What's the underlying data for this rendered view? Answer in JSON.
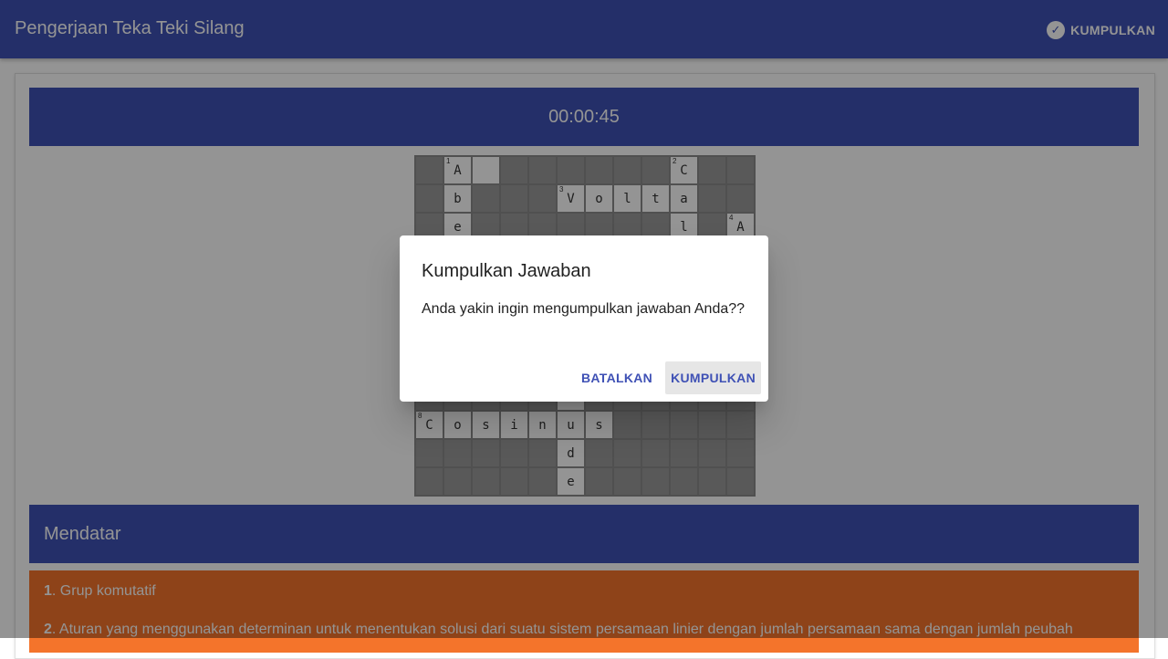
{
  "appbar": {
    "title": "Pengerjaan Teka Teki Silang",
    "submit_label": "KUMPULKAN",
    "submit_icon": "check-circle-icon"
  },
  "timer": {
    "value": "00:00:45"
  },
  "crossword": {
    "columns": 12,
    "rows": [
      [
        {
          "t": "b"
        },
        {
          "t": "w",
          "c": "A",
          "n": "1"
        },
        {
          "t": "w",
          "c": ""
        },
        {
          "t": "b"
        },
        {
          "t": "b"
        },
        {
          "t": "b"
        },
        {
          "t": "b"
        },
        {
          "t": "b"
        },
        {
          "t": "b"
        },
        {
          "t": "w",
          "c": "C",
          "n": "2"
        },
        {
          "t": "b"
        },
        {
          "t": "b"
        }
      ],
      [
        {
          "t": "b"
        },
        {
          "t": "w",
          "c": "b"
        },
        {
          "t": "b"
        },
        {
          "t": "b"
        },
        {
          "t": "b"
        },
        {
          "t": "w",
          "c": "V",
          "n": "3"
        },
        {
          "t": "w",
          "c": "o"
        },
        {
          "t": "w",
          "c": "l"
        },
        {
          "t": "w",
          "c": "t"
        },
        {
          "t": "w",
          "c": "a"
        },
        {
          "t": "b"
        },
        {
          "t": "b"
        }
      ],
      [
        {
          "t": "b"
        },
        {
          "t": "w",
          "c": "e"
        },
        {
          "t": "b"
        },
        {
          "t": "b"
        },
        {
          "t": "b"
        },
        {
          "t": "b"
        },
        {
          "t": "b"
        },
        {
          "t": "b"
        },
        {
          "t": "b"
        },
        {
          "t": "w",
          "c": "l"
        },
        {
          "t": "b"
        },
        {
          "t": "w",
          "c": "A",
          "n": "4"
        }
      ],
      [
        {
          "t": "b"
        },
        {
          "t": "w",
          "c": ""
        },
        {
          "t": "b"
        },
        {
          "t": "b"
        },
        {
          "t": "b"
        },
        {
          "t": "b"
        },
        {
          "t": "b"
        },
        {
          "t": "b"
        },
        {
          "t": "b"
        },
        {
          "t": "w",
          "c": ""
        },
        {
          "t": "b"
        },
        {
          "t": "w",
          "c": ""
        }
      ],
      [
        {
          "t": "b"
        },
        {
          "t": "w",
          "c": ""
        },
        {
          "t": "b"
        },
        {
          "t": "b"
        },
        {
          "t": "b"
        },
        {
          "t": "b"
        },
        {
          "t": "b"
        },
        {
          "t": "b"
        },
        {
          "t": "b"
        },
        {
          "t": "w",
          "c": ""
        },
        {
          "t": "b"
        },
        {
          "t": "w",
          "c": ""
        }
      ],
      [
        {
          "t": "b"
        },
        {
          "t": "w",
          "c": ""
        },
        {
          "t": "b"
        },
        {
          "t": "b"
        },
        {
          "t": "b"
        },
        {
          "t": "b"
        },
        {
          "t": "b"
        },
        {
          "t": "b"
        },
        {
          "t": "b"
        },
        {
          "t": "w",
          "c": ""
        },
        {
          "t": "b"
        },
        {
          "t": "w",
          "c": ""
        }
      ],
      [
        {
          "t": "b"
        },
        {
          "t": "w",
          "c": ""
        },
        {
          "t": "b"
        },
        {
          "t": "b"
        },
        {
          "t": "b"
        },
        {
          "t": "b"
        },
        {
          "t": "b"
        },
        {
          "t": "b"
        },
        {
          "t": "b"
        },
        {
          "t": "w",
          "c": ""
        },
        {
          "t": "b"
        },
        {
          "t": "w",
          "c": ""
        }
      ],
      [
        {
          "t": "b"
        },
        {
          "t": "w",
          "c": ""
        },
        {
          "t": "b"
        },
        {
          "t": "b"
        },
        {
          "t": "b"
        },
        {
          "t": "b"
        },
        {
          "t": "b"
        },
        {
          "t": "b"
        },
        {
          "t": "b"
        },
        {
          "t": "w",
          "c": ""
        },
        {
          "t": "b"
        },
        {
          "t": "w",
          "c": ""
        }
      ],
      [
        {
          "t": "b"
        },
        {
          "t": "b"
        },
        {
          "t": "b"
        },
        {
          "t": "b"
        },
        {
          "t": "b"
        },
        {
          "t": "w",
          "c": ""
        },
        {
          "t": "b"
        },
        {
          "t": "b"
        },
        {
          "t": "b"
        },
        {
          "t": "b"
        },
        {
          "t": "b"
        },
        {
          "t": "b"
        }
      ],
      [
        {
          "t": "w",
          "c": "C",
          "n": "8"
        },
        {
          "t": "w",
          "c": "o"
        },
        {
          "t": "w",
          "c": "s"
        },
        {
          "t": "w",
          "c": "i"
        },
        {
          "t": "w",
          "c": "n"
        },
        {
          "t": "w",
          "c": "u"
        },
        {
          "t": "w",
          "c": "s"
        },
        {
          "t": "b"
        },
        {
          "t": "b"
        },
        {
          "t": "b"
        },
        {
          "t": "b"
        },
        {
          "t": "b"
        }
      ],
      [
        {
          "t": "b"
        },
        {
          "t": "b"
        },
        {
          "t": "b"
        },
        {
          "t": "b"
        },
        {
          "t": "b"
        },
        {
          "t": "w",
          "c": "d"
        },
        {
          "t": "b"
        },
        {
          "t": "b"
        },
        {
          "t": "b"
        },
        {
          "t": "b"
        },
        {
          "t": "b"
        },
        {
          "t": "b"
        }
      ],
      [
        {
          "t": "b"
        },
        {
          "t": "b"
        },
        {
          "t": "b"
        },
        {
          "t": "b"
        },
        {
          "t": "b"
        },
        {
          "t": "w",
          "c": "e"
        },
        {
          "t": "b"
        },
        {
          "t": "b"
        },
        {
          "t": "b"
        },
        {
          "t": "b"
        },
        {
          "t": "b"
        },
        {
          "t": "b"
        }
      ]
    ]
  },
  "mendatar": {
    "heading": "Mendatar",
    "clues": [
      {
        "num": "1",
        "text": ". Grup komutatif"
      },
      {
        "num": "2",
        "text": ". Aturan yang menggunakan determinan untuk menentukan solusi dari suatu sistem persamaan linier dengan jumlah persamaan sama dengan jumlah peubah"
      }
    ]
  },
  "dialog": {
    "title": "Kumpulkan Jawaban",
    "body": "Anda yakin ingin mengumpulkan jawaban Anda??",
    "cancel_label": "BATALKAN",
    "confirm_label": "KUMPULKAN"
  }
}
